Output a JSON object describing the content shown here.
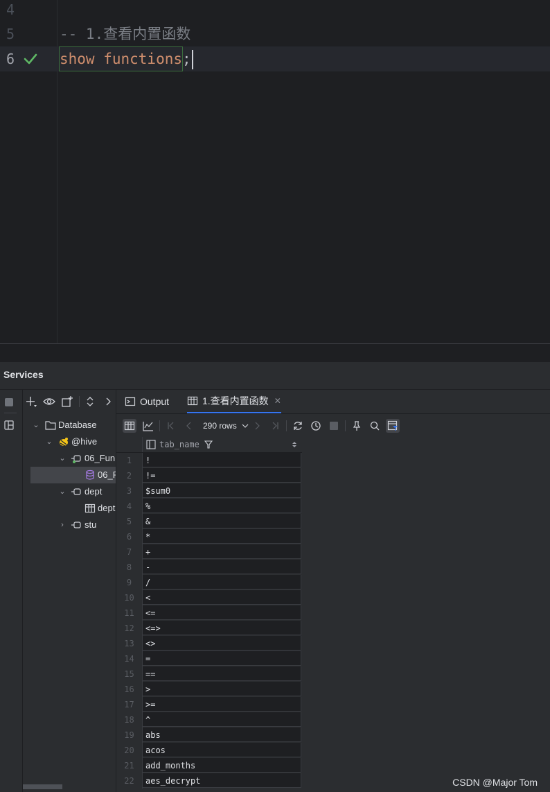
{
  "editor": {
    "lines": [
      {
        "number": "4",
        "text": ""
      },
      {
        "number": "5",
        "text": "-- 1.查看内置函数"
      },
      {
        "number": "6",
        "keyword": "show functions",
        "tail": ";"
      }
    ]
  },
  "services": {
    "title": "Services",
    "tree": [
      {
        "label": "Database"
      },
      {
        "label": "@hive"
      },
      {
        "label": "06_Fun"
      },
      {
        "label": "06_F"
      },
      {
        "label": "dept"
      },
      {
        "label": "dept"
      },
      {
        "label": "stu"
      }
    ],
    "tabs": [
      {
        "label": "Output"
      },
      {
        "label": "1.查看内置函数"
      }
    ],
    "rows_label": "290 rows",
    "column": "tab_name",
    "rows": [
      {
        "n": "1",
        "v": "!"
      },
      {
        "n": "2",
        "v": "!="
      },
      {
        "n": "3",
        "v": "$sum0"
      },
      {
        "n": "4",
        "v": "%"
      },
      {
        "n": "5",
        "v": "&"
      },
      {
        "n": "6",
        "v": "*"
      },
      {
        "n": "7",
        "v": "+"
      },
      {
        "n": "8",
        "v": "-"
      },
      {
        "n": "9",
        "v": "/"
      },
      {
        "n": "10",
        "v": "<"
      },
      {
        "n": "11",
        "v": "<="
      },
      {
        "n": "12",
        "v": "<=>"
      },
      {
        "n": "13",
        "v": "<>"
      },
      {
        "n": "14",
        "v": "="
      },
      {
        "n": "15",
        "v": "=="
      },
      {
        "n": "16",
        "v": ">"
      },
      {
        "n": "17",
        "v": ">="
      },
      {
        "n": "18",
        "v": "^"
      },
      {
        "n": "19",
        "v": "abs"
      },
      {
        "n": "20",
        "v": "acos"
      },
      {
        "n": "21",
        "v": "add_months"
      },
      {
        "n": "22",
        "v": "aes_decrypt"
      }
    ]
  },
  "watermark": "CSDN @Major Tom",
  "colors": {
    "accent": "#3574f0",
    "keyword": "#cf8e6d",
    "check": "#5fb865"
  }
}
